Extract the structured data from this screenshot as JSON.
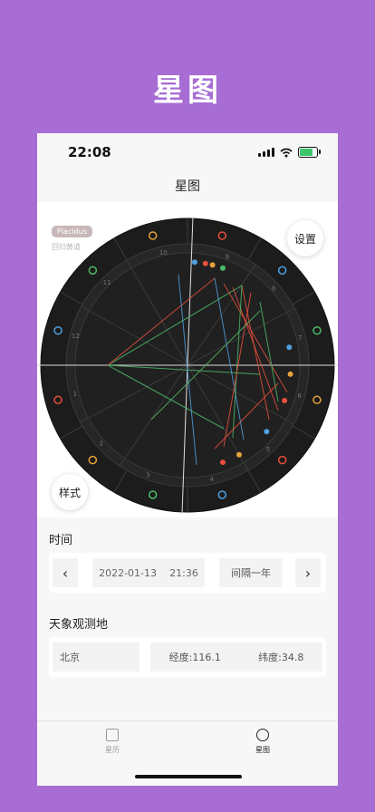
{
  "header": {
    "title": "星图"
  },
  "status_bar": {
    "time": "22:08"
  },
  "nav": {
    "title": "星图"
  },
  "chart": {
    "house_system": "Placidus",
    "zodiac_mode": "回归黄道",
    "settings_label": "设置",
    "style_label": "样式",
    "colors": {
      "fire": "#e8503c",
      "earth": "#e8a23c",
      "air": "#4dbb6a",
      "water": "#4fa0e0",
      "ring": "#1c1c1c",
      "inner": "#262626"
    },
    "house_numbers": [
      "1",
      "2",
      "3",
      "4",
      "5",
      "6",
      "7",
      "8",
      "9",
      "10",
      "11",
      "12"
    ],
    "signs": [
      "aries-icon",
      "taurus-icon",
      "gemini-icon",
      "cancer-icon",
      "leo-icon",
      "virgo-icon",
      "libra-icon",
      "scorpio-icon",
      "sagittarius-icon",
      "capricorn-icon",
      "aquarius-icon",
      "pisces-icon"
    ]
  },
  "time_section": {
    "title": "时间",
    "prev_label": "‹",
    "next_label": "›",
    "date": "2022-01-13",
    "time": "21:36",
    "interval": "间隔一年"
  },
  "location_section": {
    "title": "天象观测地",
    "city": "北京",
    "longitude": "经度:116.1",
    "latitude": "纬度:34.8"
  },
  "tabs": [
    {
      "label": "星历",
      "icon": "calendar-icon"
    },
    {
      "label": "星图",
      "icon": "chart-icon"
    }
  ]
}
